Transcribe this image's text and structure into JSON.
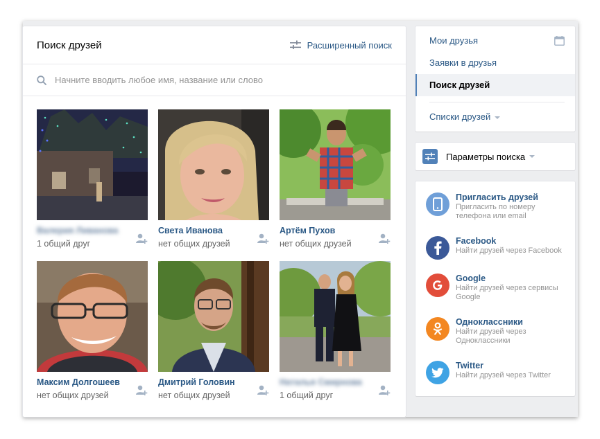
{
  "main": {
    "title": "Поиск друзей",
    "advanced_search": "Расширенный поиск",
    "search_placeholder": "Начните вводить любое имя, название или слово",
    "cards": [
      {
        "name": "Валерия Ливанова",
        "blurred": true,
        "sub": "1 общий друг"
      },
      {
        "name": "Света Иванова",
        "blurred": false,
        "sub": "нет общих друзей"
      },
      {
        "name": "Артём Пухов",
        "blurred": false,
        "sub": "нет общих друзей"
      },
      {
        "name": "Максим Долгошеев",
        "blurred": false,
        "sub": "нет общих друзей"
      },
      {
        "name": "Дмитрий Головин",
        "blurred": false,
        "sub": "нет общих друзей"
      },
      {
        "name": "Наталья Смирнова",
        "blurred": true,
        "sub": "1 общий друг"
      }
    ]
  },
  "nav": {
    "my_friends": "Мои друзья",
    "requests": "Заявки в друзья",
    "search": "Поиск друзей",
    "lists": "Списки друзей"
  },
  "params": {
    "label": "Параметры поиска"
  },
  "invite": [
    {
      "title": "Пригласить друзей",
      "desc": "Пригласить по номеру телефона или email",
      "icon": "phone-icon",
      "color": "#6f9fd8"
    },
    {
      "title": "Facebook",
      "desc": "Найти друзей через Facebook",
      "icon": "facebook-icon",
      "color": "#3b5998"
    },
    {
      "title": "Google",
      "desc": "Найти друзей через сервисы Google",
      "icon": "google-icon",
      "color": "#e24d3a"
    },
    {
      "title": "Одноклассники",
      "desc": "Найти друзей через Одноклассники",
      "icon": "odnoklassniki-icon",
      "color": "#f38721"
    },
    {
      "title": "Twitter",
      "desc": "Найти друзей через Twitter",
      "icon": "twitter-icon",
      "color": "#3fa3e4"
    }
  ],
  "colors": {
    "link": "#2a5885",
    "accent": "#5181b8",
    "background": "#edeef0"
  }
}
